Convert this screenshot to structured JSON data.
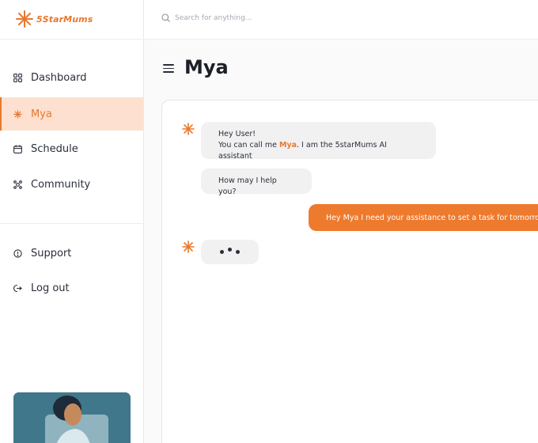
{
  "brand": {
    "name": "5StarMums",
    "accent": "#e9782d"
  },
  "search": {
    "placeholder": "Search for anything..."
  },
  "sidebar": {
    "items": [
      {
        "label": "Dashboard",
        "icon": "grid-icon"
      },
      {
        "label": "Mya",
        "icon": "star-burst-icon",
        "active": true
      },
      {
        "label": "Schedule",
        "icon": "calendar-icon"
      },
      {
        "label": "Community",
        "icon": "community-icon"
      }
    ],
    "secondary": [
      {
        "label": "Support",
        "icon": "support-icon"
      },
      {
        "label": "Log out",
        "icon": "logout-icon"
      }
    ]
  },
  "page": {
    "title": "Mya"
  },
  "chat": {
    "messages": [
      {
        "from": "assistant",
        "line1": "Hey User!",
        "line2_before": "You can call me ",
        "line2_name": "Mya",
        "line2_after": ".  I am the 5starMums AI assistant"
      },
      {
        "from": "assistant",
        "text": "How may I help you?"
      },
      {
        "from": "user",
        "text": "Hey Mya I need your assistance to set a task for tomorrow"
      },
      {
        "from": "assistant",
        "typing": true
      }
    ]
  }
}
